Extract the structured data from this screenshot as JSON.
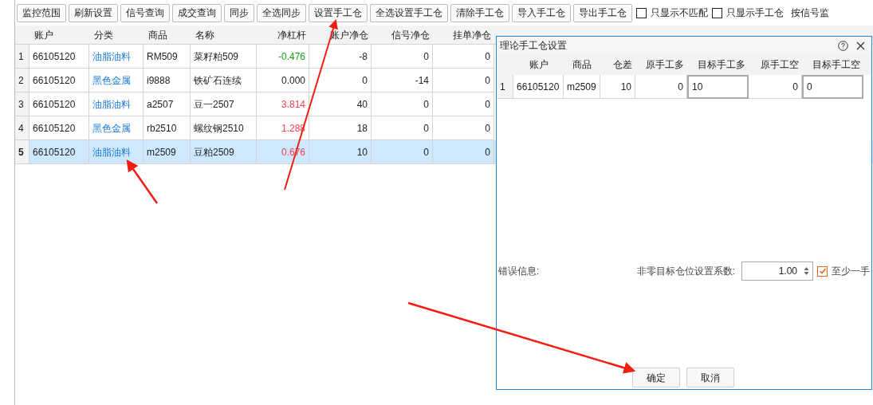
{
  "toolbar": {
    "buttons": [
      "监控范围",
      "刷新设置",
      "信号查询",
      "成交查询",
      "同步",
      "全选同步",
      "设置手工仓",
      "全选设置手工仓",
      "清除手工仓",
      "导入手工仓",
      "导出手工仓"
    ],
    "checkboxes": [
      {
        "label": "只显示不匹配",
        "checked": false
      },
      {
        "label": "只显示手工仓",
        "checked": false
      }
    ],
    "trailing_text": "按信号监"
  },
  "table": {
    "columns": [
      "账户",
      "分类",
      "商品",
      "名称",
      "净杠杆",
      "账户净仓",
      "信号净仓",
      "挂单净仓"
    ],
    "rows": [
      {
        "index": "1",
        "account": "66105120",
        "category": "油脂油料",
        "symbol": "RM509",
        "name": "菜籽粕509",
        "leverage": "-0.476",
        "color": "#16a016",
        "account_net": "-8",
        "signal_net": "0",
        "order_net": "0",
        "selected": false
      },
      {
        "index": "2",
        "account": "66105120",
        "category": "黑色金属",
        "symbol": "i9888",
        "name": "铁矿石连续",
        "leverage": "0.000",
        "color": "#222222",
        "account_net": "0",
        "signal_net": "-14",
        "order_net": "0",
        "selected": false
      },
      {
        "index": "3",
        "account": "66105120",
        "category": "油脂油料",
        "symbol": "a2507",
        "name": "豆一2507",
        "leverage": "3.814",
        "color": "#f2424a",
        "account_net": "40",
        "signal_net": "0",
        "order_net": "0",
        "selected": false
      },
      {
        "index": "4",
        "account": "66105120",
        "category": "黑色金属",
        "symbol": "rb2510",
        "name": "螺纹钢2510",
        "leverage": "1.288",
        "color": "#f2424a",
        "account_net": "18",
        "signal_net": "0",
        "order_net": "0",
        "selected": false
      },
      {
        "index": "5",
        "account": "66105120",
        "category": "油脂油料",
        "symbol": "m2509",
        "name": "豆粕2509",
        "leverage": "0.676",
        "color": "#f2424a",
        "account_net": "10",
        "signal_net": "0",
        "order_net": "0",
        "selected": true
      }
    ]
  },
  "dialog": {
    "title": "理论手工仓设置",
    "columns": [
      "账户",
      "商品",
      "仓差",
      "原手工多",
      "目标手工多",
      "原手工空",
      "目标手工空"
    ],
    "rows": [
      {
        "index": "1",
        "account": "66105120",
        "symbol": "m2509",
        "diff": "10",
        "orig_long": "0",
        "target_long": "10",
        "orig_short": "0",
        "target_short": "0"
      }
    ],
    "error_label": "错误信息:",
    "factor_label": "非零目标仓位设置系数:",
    "factor_value": "1.00",
    "min_one": {
      "label": "至少一手",
      "checked": true
    },
    "buttons": [
      "确定",
      "取消"
    ]
  }
}
